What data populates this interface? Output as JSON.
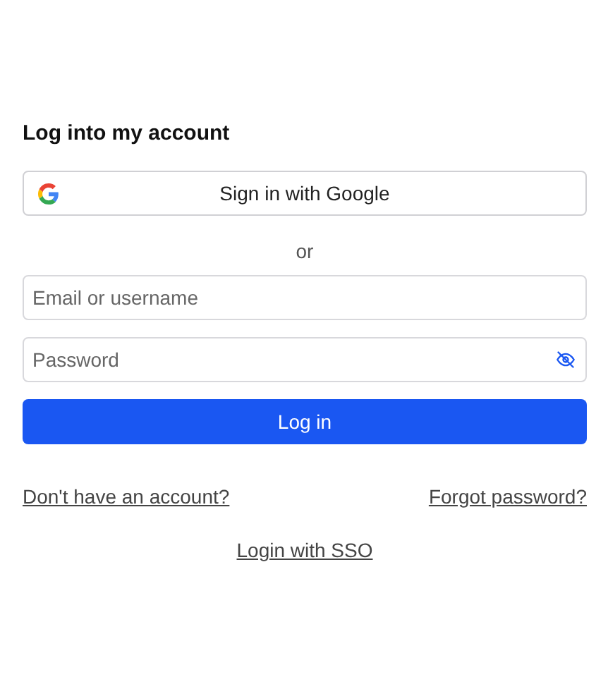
{
  "title": "Log into my account",
  "google_button": {
    "label": "Sign in with Google"
  },
  "separator": "or",
  "email": {
    "placeholder": "Email or username"
  },
  "password": {
    "placeholder": "Password"
  },
  "submit": {
    "label": "Log in"
  },
  "links": {
    "signup": "Don't have an account?",
    "forgot": "Forgot password?",
    "sso": "Login with SSO"
  }
}
